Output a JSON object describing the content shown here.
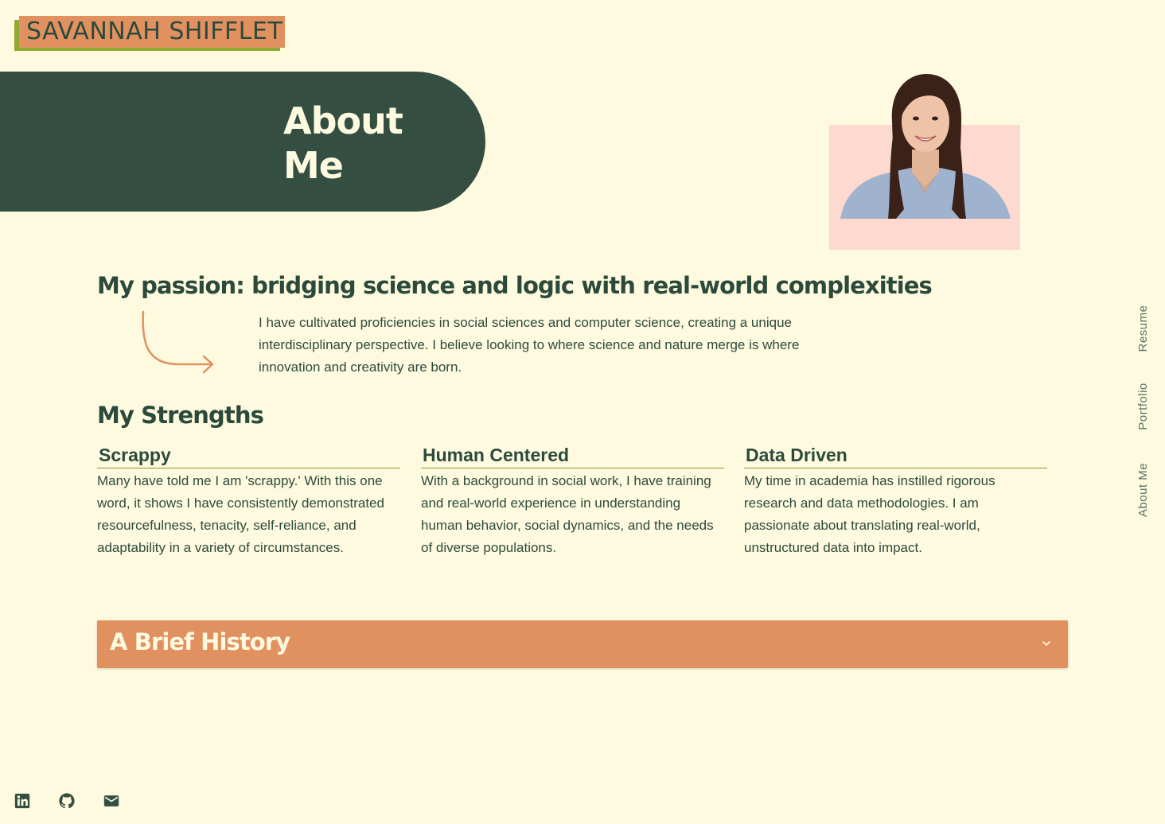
{
  "logo": {
    "text": "SAVANNAH SHIFFLET"
  },
  "hero": {
    "title_line1": "About",
    "title_line2": "Me"
  },
  "portrait": {
    "icon": "portrait-photo"
  },
  "passion": {
    "title": "My passion: bridging science and logic with real-world complexities",
    "text": "I have cultivated proficiencies in social sciences and computer science, creating a unique interdisciplinary perspective. I believe looking to where science and nature merge is where innovation and creativity are born."
  },
  "strengths": {
    "title": "My Strengths",
    "items": [
      {
        "title": "Scrappy",
        "text": "Many have told me I am 'scrappy.' With this one word, it shows I have consistently demonstrated resourcefulness, tenacity, self-reliance, and adaptability in a variety of circumstances."
      },
      {
        "title": "Human Centered",
        "text": "With a background in social work, I have training and real-world experience in understanding human behavior, social dynamics, and the needs of diverse populations."
      },
      {
        "title": "Data Driven",
        "text": "My time in academia has instilled rigorous research and data methodologies. I am passionate about translating real-world, unstructured data into impact."
      }
    ]
  },
  "accordion": {
    "title": "A Brief History",
    "icon": "chevron-down-icon"
  },
  "nav": {
    "resume": "Resume",
    "portfolio": "Portfolio",
    "about": "About Me"
  },
  "social": {
    "linkedin": "linkedin-icon",
    "github": "github-icon",
    "email": "email-icon"
  },
  "colors": {
    "background": "#fefadf",
    "dark_green": "#344e41",
    "orange": "#e1915f",
    "olive": "#8faa33",
    "pink": "#fdd9cf"
  }
}
